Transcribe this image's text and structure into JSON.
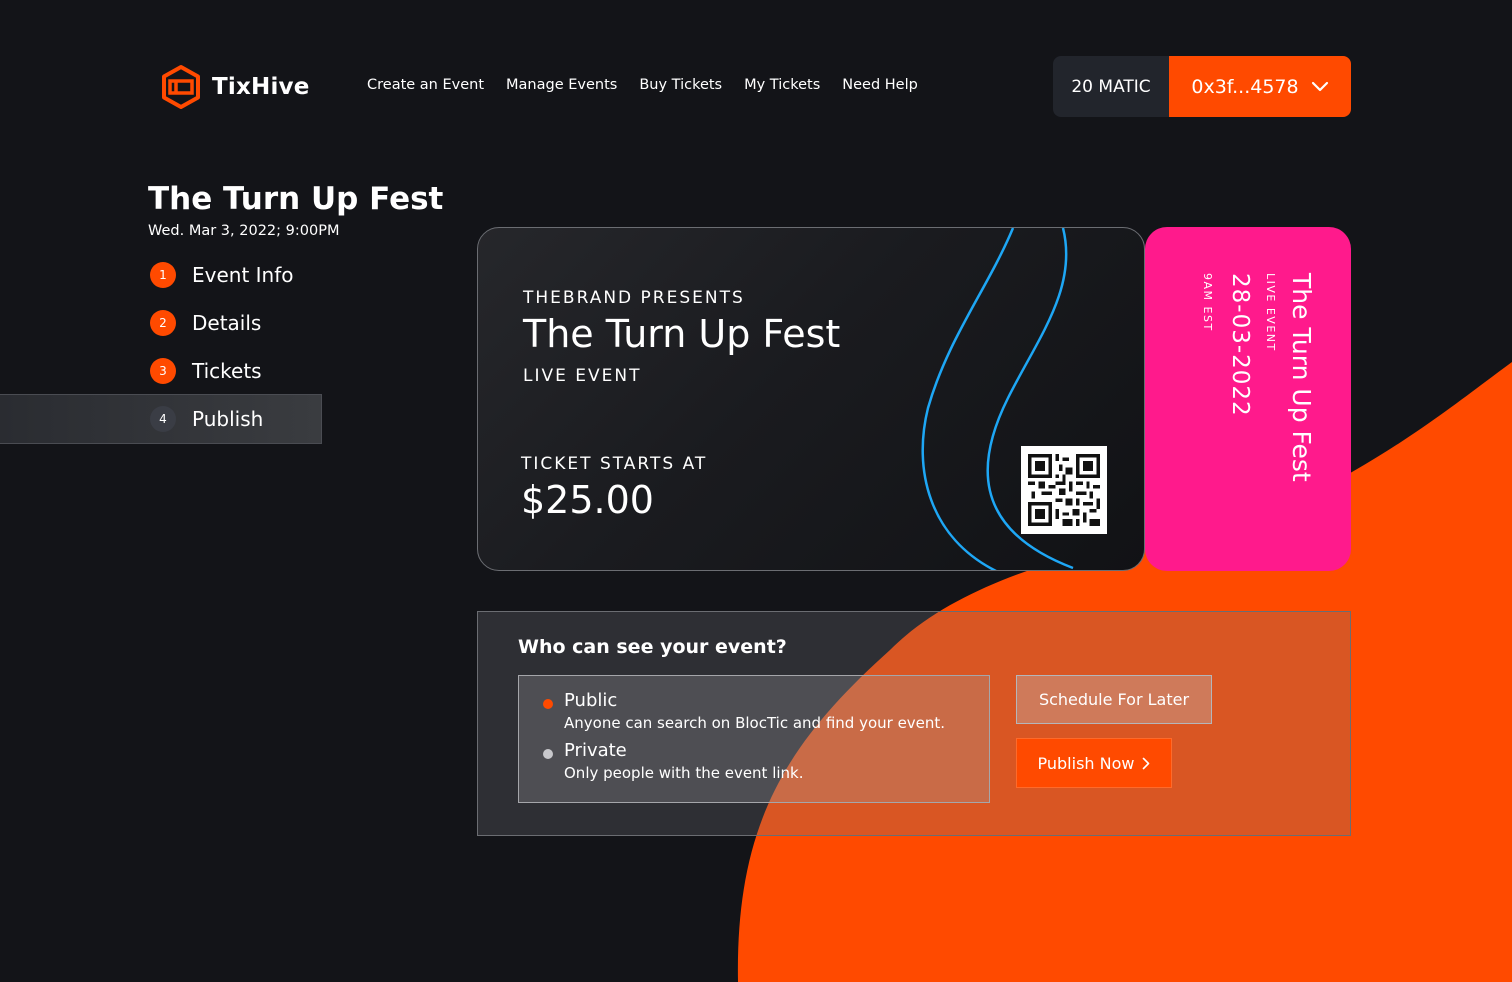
{
  "brand": {
    "name": "TixHive",
    "accent": "#ff4a00",
    "logo_icon": "hexagon-ticket-icon"
  },
  "nav": [
    {
      "label": "Create an Event"
    },
    {
      "label": "Manage Events"
    },
    {
      "label": "Buy Tickets"
    },
    {
      "label": "My Tickets"
    },
    {
      "label": "Need Help"
    }
  ],
  "wallet": {
    "balance": "20 MATIC",
    "address": "0x3f...4578",
    "dropdown_icon": "chevron-down-icon"
  },
  "event": {
    "title": "The Turn Up Fest",
    "date": "Wed. Mar 3, 2022; 9:00PM"
  },
  "steps": [
    {
      "number": "1",
      "label": "Event Info"
    },
    {
      "number": "2",
      "label": "Details"
    },
    {
      "number": "3",
      "label": "Tickets"
    },
    {
      "number": "4",
      "label": "Publish",
      "active": true
    }
  ],
  "ticket": {
    "presents": "THEBRAND PRESENTS",
    "name": "The Turn Up Fest",
    "type": "LIVE EVENT",
    "price_label": "TICKET STARTS AT",
    "price": "$25.00",
    "stub": {
      "name": "The Turn Up Fest",
      "kind": "LIVE EVENT",
      "date": "28-03-2022",
      "time": "9AM EST",
      "color": "#ff1a8c"
    }
  },
  "visibility": {
    "title": "Who can see your event?",
    "options": [
      {
        "label": "Public",
        "description": "Anyone can search on BlocTic and find your event.",
        "selected": true
      },
      {
        "label": "Private",
        "description": "Only people with the event link.",
        "selected": false
      }
    ],
    "schedule_label": "Schedule For Later",
    "publish_label": "Publish Now"
  }
}
